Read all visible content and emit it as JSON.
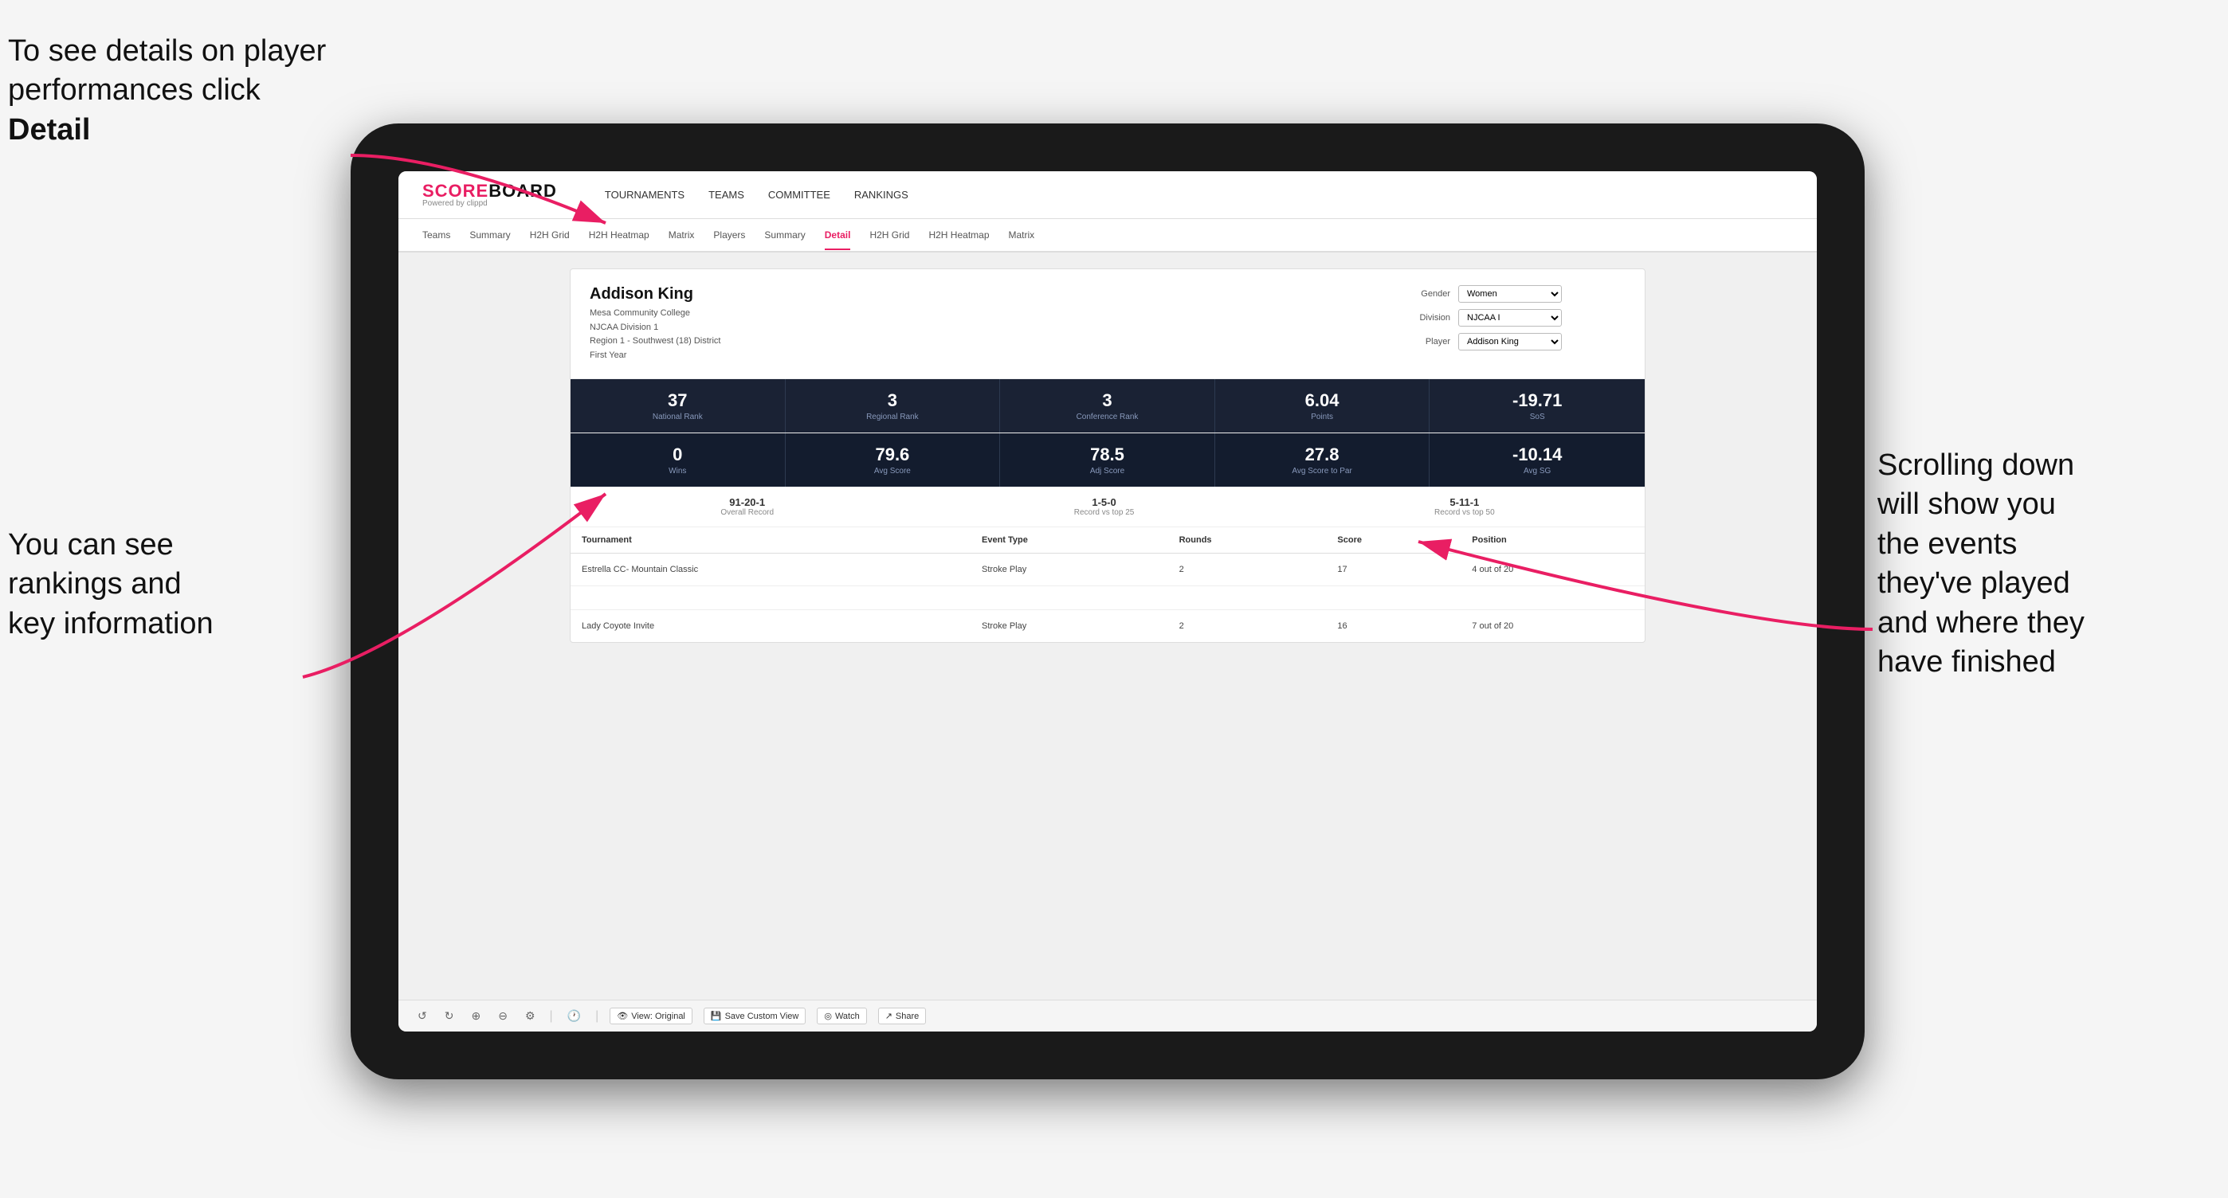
{
  "annotations": {
    "top_left": "To see details on player performances click ",
    "top_left_bold": "Detail",
    "bottom_left_line1": "You can see",
    "bottom_left_line2": "rankings and",
    "bottom_left_line3": "key information",
    "right_line1": "Scrolling down",
    "right_line2": "will show you",
    "right_line3": "the events",
    "right_line4": "they've played",
    "right_line5": "and where they",
    "right_line6": "have finished"
  },
  "nav": {
    "logo_main": "SCOREBOARD",
    "logo_sub": "Powered by clippd",
    "items": [
      "TOURNAMENTS",
      "TEAMS",
      "COMMITTEE",
      "RANKINGS"
    ]
  },
  "sub_tabs": {
    "items": [
      "Teams",
      "Summary",
      "H2H Grid",
      "H2H Heatmap",
      "Matrix",
      "Players",
      "Summary",
      "Detail",
      "H2H Grid",
      "H2H Heatmap",
      "Matrix"
    ],
    "active": "Detail"
  },
  "player": {
    "name": "Addison King",
    "college": "Mesa Community College",
    "division": "NJCAA Division 1",
    "region": "Region 1 - Southwest (18) District",
    "year": "First Year"
  },
  "filters": {
    "gender_label": "Gender",
    "gender_value": "Women",
    "division_label": "Division",
    "division_value": "NJCAA I",
    "player_label": "Player",
    "player_value": "Addison King"
  },
  "stats_row1": [
    {
      "value": "37",
      "label": "National Rank"
    },
    {
      "value": "3",
      "label": "Regional Rank"
    },
    {
      "value": "3",
      "label": "Conference Rank"
    },
    {
      "value": "6.04",
      "label": "Points"
    },
    {
      "value": "-19.71",
      "label": "SoS"
    }
  ],
  "stats_row2": [
    {
      "value": "0",
      "label": "Wins"
    },
    {
      "value": "79.6",
      "label": "Avg Score"
    },
    {
      "value": "78.5",
      "label": "Adj Score"
    },
    {
      "value": "27.8",
      "label": "Avg Score to Par"
    },
    {
      "value": "-10.14",
      "label": "Avg SG"
    }
  ],
  "records": [
    {
      "value": "91-20-1",
      "label": "Overall Record"
    },
    {
      "value": "1-5-0",
      "label": "Record vs top 25"
    },
    {
      "value": "5-11-1",
      "label": "Record vs top 50"
    }
  ],
  "table": {
    "headers": [
      "Tournament",
      "Event Type",
      "Rounds",
      "Score",
      "Position"
    ],
    "rows": [
      {
        "tournament": "Estrella CC- Mountain Classic",
        "event_type": "Stroke Play",
        "rounds": "2",
        "score": "17",
        "position": "4 out of 20"
      },
      {
        "tournament": "",
        "event_type": "",
        "rounds": "",
        "score": "",
        "position": ""
      },
      {
        "tournament": "Lady Coyote Invite",
        "event_type": "Stroke Play",
        "rounds": "2",
        "score": "16",
        "position": "7 out of 20"
      }
    ]
  },
  "toolbar": {
    "view_original": "View: Original",
    "save_custom": "Save Custom View",
    "watch": "Watch",
    "share": "Share"
  }
}
